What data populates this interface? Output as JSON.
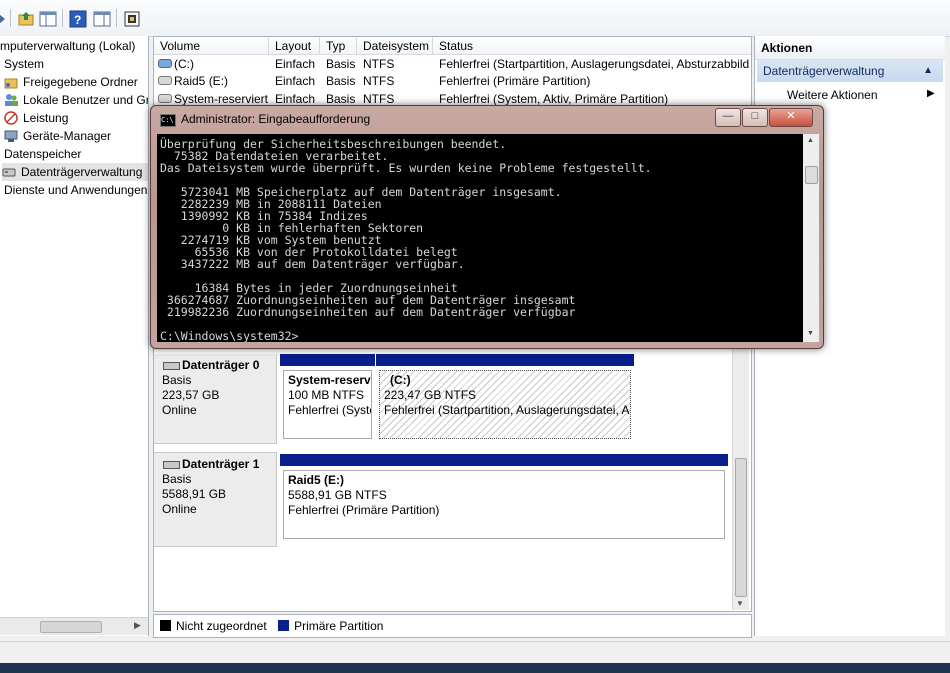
{
  "tree": {
    "items": [
      {
        "label": "mputerverwaltung (Lokal)",
        "icon": "computer-icon"
      },
      {
        "label": "System",
        "icon": ""
      },
      {
        "label": "Freigegebene Ordner",
        "icon": "shared-folder-icon"
      },
      {
        "label": "Lokale Benutzer und Gr",
        "icon": "users-icon"
      },
      {
        "label": "Leistung",
        "icon": "performance-icon"
      },
      {
        "label": "Geräte-Manager",
        "icon": "device-manager-icon"
      },
      {
        "label": "Datenspeicher",
        "icon": ""
      },
      {
        "label": "Datenträgerverwaltung",
        "icon": "disk-management-icon"
      },
      {
        "label": "Dienste und Anwendungen",
        "icon": ""
      }
    ]
  },
  "volumes": {
    "headers": [
      "Volume",
      "Layout",
      "Typ",
      "Dateisystem",
      "Status"
    ],
    "rows": [
      {
        "volume": "(C:)",
        "layout": "Einfach",
        "typ": "Basis",
        "fs": "NTFS",
        "status": "Fehlerfrei (Startpartition, Auslagerungsdatei, Absturzabbild"
      },
      {
        "volume": "Raid5 (E:)",
        "layout": "Einfach",
        "typ": "Basis",
        "fs": "NTFS",
        "status": "Fehlerfrei (Primäre Partition)"
      },
      {
        "volume": "System-reserviert",
        "layout": "Einfach",
        "typ": "Basis",
        "fs": "NTFS",
        "status": "Fehlerfrei (System, Aktiv, Primäre Partition)"
      }
    ]
  },
  "cmd": {
    "title": "Administrator: Eingabeaufforderung",
    "icon_text": "C:\\",
    "lines": [
      "Überprüfung der Sicherheitsbeschreibungen beendet.",
      "  75382 Datendateien verarbeitet.",
      "Das Dateisystem wurde überprüft. Es wurden keine Probleme festgestellt.",
      "",
      "   5723041 MB Speicherplatz auf dem Datenträger insgesamt.",
      "   2282239 MB in 2088111 Dateien",
      "   1390992 KB in 75384 Indizes",
      "         0 KB in fehlerhaften Sektoren",
      "   2274719 KB vom System benutzt",
      "     65536 KB von der Protokolldatei belegt",
      "   3437222 MB auf dem Datenträger verfügbar.",
      "",
      "     16384 Bytes in jeder Zuordnungseinheit",
      " 366274687 Zuordnungseinheiten auf dem Datenträger insgesamt",
      " 219982236 Zuordnungseinheiten auf dem Datenträger verfügbar",
      "",
      "C:\\Windows\\system32>_"
    ]
  },
  "disks": [
    {
      "name": "Datenträger 0",
      "type": "Basis",
      "size": "223,57 GB",
      "state": "Online",
      "partitions": [
        {
          "title": "System-reserv",
          "size": "100 MB NTFS",
          "status": "Fehlerfrei (Syste"
        },
        {
          "title": "(C:)",
          "size": "223,47 GB NTFS",
          "status": "Fehlerfrei (Startpartition, Auslagerungsdatei, A"
        }
      ]
    },
    {
      "name": "Datenträger 1",
      "type": "Basis",
      "size": "5588,91 GB",
      "state": "Online",
      "partitions": [
        {
          "title": "Raid5  (E:)",
          "size": "5588,91 GB NTFS",
          "status": "Fehlerfrei (Primäre Partition)"
        }
      ]
    }
  ],
  "legend": {
    "unallocated": "Nicht zugeordnet",
    "primary": "Primäre Partition"
  },
  "actions": {
    "title": "Aktionen",
    "section": "Datenträgerverwaltung",
    "more": "Weitere Aktionen"
  },
  "colors": {
    "primary_partition": "#0a1e8c",
    "unallocated": "#000000",
    "action_section": "#c8d9ee"
  }
}
